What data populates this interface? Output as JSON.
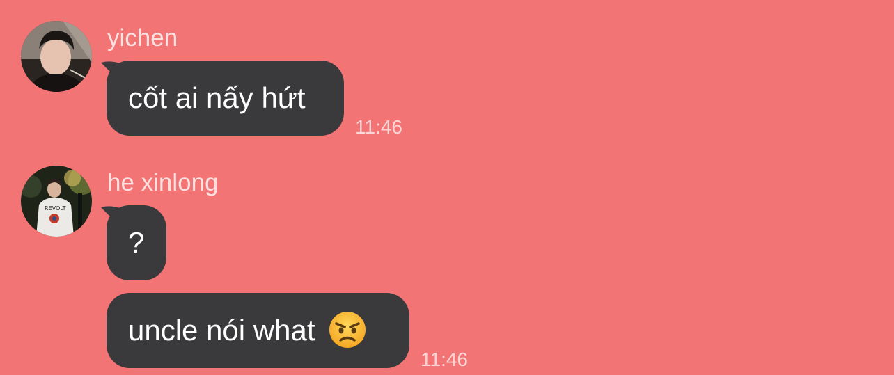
{
  "colors": {
    "background": "#f27474",
    "bubble": "#3a3a3c",
    "bubble_text": "#ffffff",
    "name_text": "#fbe0e0",
    "time_text": "#fbd6d6"
  },
  "messages": [
    {
      "sender": "yichen",
      "avatar_icon": "avatar-photo",
      "bubbles": [
        {
          "text": "cốt ai nấy hứt"
        }
      ],
      "time": "11:46"
    },
    {
      "sender": "he xinlong",
      "avatar_icon": "avatar-photo",
      "bubbles": [
        {
          "text": "?"
        },
        {
          "text": "uncle nói what",
          "emoji": "angry-face-icon"
        }
      ],
      "time": "11:46"
    }
  ]
}
